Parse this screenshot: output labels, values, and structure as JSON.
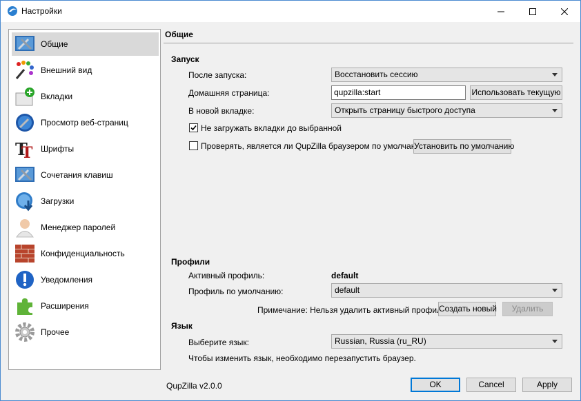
{
  "window": {
    "title": "Настройки",
    "controls": {
      "minimize": "minimize",
      "maximize": "maximize",
      "close": "close"
    }
  },
  "sidebar": {
    "items": [
      {
        "label": "Общие",
        "icon": "general-icon",
        "selected": true
      },
      {
        "label": "Внешний вид",
        "icon": "appearance-icon",
        "selected": false
      },
      {
        "label": "Вкладки",
        "icon": "tabs-icon",
        "selected": false
      },
      {
        "label": "Просмотр веб-страниц",
        "icon": "browsing-icon",
        "selected": false
      },
      {
        "label": "Шрифты",
        "icon": "fonts-icon",
        "selected": false
      },
      {
        "label": "Сочетания клавиш",
        "icon": "shortcuts-icon",
        "selected": false
      },
      {
        "label": "Загрузки",
        "icon": "downloads-icon",
        "selected": false
      },
      {
        "label": "Менеджер паролей",
        "icon": "password-manager-icon",
        "selected": false
      },
      {
        "label": "Конфиденциальность",
        "icon": "privacy-icon",
        "selected": false
      },
      {
        "label": "Уведомления",
        "icon": "notifications-icon",
        "selected": false
      },
      {
        "label": "Расширения",
        "icon": "extensions-icon",
        "selected": false
      },
      {
        "label": "Прочее",
        "icon": "other-icon",
        "selected": false
      }
    ]
  },
  "page": {
    "title": "Общие",
    "startup": {
      "heading": "Запуск",
      "after_launch_label": "После запуска:",
      "after_launch_value": "Восстановить сессию",
      "homepage_label": "Домашняя страница:",
      "homepage_value": "qupzilla:start",
      "use_current_button": "Использовать текущую",
      "new_tab_label": "В новой вкладке:",
      "new_tab_value": "Открыть страницу быстрого доступа",
      "dont_load_tabs_label": "Не загружать вкладки до выбранной",
      "dont_load_tabs_checked": true,
      "check_default_label": "Проверять, является ли QupZilla браузером по умолчанию",
      "check_default_checked": false,
      "set_default_button": "Установить по умолчанию"
    },
    "profiles": {
      "heading": "Профили",
      "active_label": "Активный профиль:",
      "active_value": "default",
      "default_label": "Профиль по умолчанию:",
      "default_value": "default",
      "note": "Примечание: Нельзя удалить активный профиль.",
      "create_button": "Создать новый",
      "delete_button": "Удалить"
    },
    "language": {
      "heading": "Язык",
      "choose_label": "Выберите язык:",
      "choose_value": "Russian, Russia (ru_RU)",
      "restart_note": "Чтобы изменить язык, необходимо перезапустить браузер."
    }
  },
  "footer": {
    "version": "QupZilla v2.0.0",
    "ok_button": "OK",
    "cancel_button": "Cancel",
    "apply_button": "Apply"
  }
}
